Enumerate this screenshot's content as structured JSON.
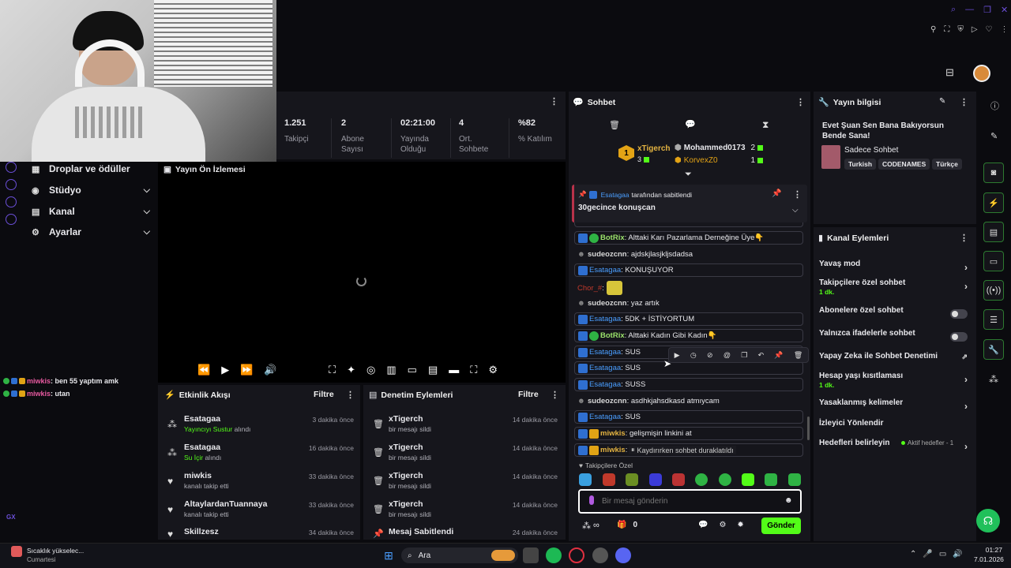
{
  "nav": {
    "items": [
      {
        "label": "Droplar ve ödüller"
      },
      {
        "label": "Stüdyo"
      },
      {
        "label": "Kanal"
      },
      {
        "label": "Ayarlar"
      }
    ]
  },
  "stats": [
    {
      "value": "1.251",
      "label": "Takipçi"
    },
    {
      "value": "2",
      "label": "Abone Sayısı"
    },
    {
      "value": "02:21:00",
      "label": "Yayında Olduğu"
    },
    {
      "value": "4",
      "label": "Ort. Sohbete"
    },
    {
      "value": "%82",
      "label": "% Katılım"
    }
  ],
  "preview": {
    "title": "Yayın Ön İzlemesi"
  },
  "overlay_chat": [
    {
      "user": "miwkis",
      "text": ": ben 55 yaptım amk"
    },
    {
      "user": "miwkis",
      "text": ": utan"
    }
  ],
  "activity": {
    "title": "Etkinlik Akışı",
    "filter": "Filtre",
    "items": [
      {
        "name": "Esatagaa",
        "action": "Yayıncıyı Sustur",
        "suffix": " alındı",
        "time": "3 dakika önce"
      },
      {
        "name": "Esatagaa",
        "action": "Su İçir",
        "suffix": " alındı",
        "time": "16 dakika önce"
      },
      {
        "name": "miwkis",
        "sub": "kanalı takip etti",
        "time": "33 dakika önce"
      },
      {
        "name": "AltaylardanTuannaya",
        "sub": "kanalı takip etti",
        "time": "33 dakika önce"
      },
      {
        "name": "Skillzesz",
        "time": "34 dakika önce"
      }
    ]
  },
  "moderation": {
    "title": "Denetim Eylemleri",
    "filter": "Filtre",
    "items": [
      {
        "name": "xTigerch",
        "sub": "bir mesajı sildi",
        "time": "14 dakika önce"
      },
      {
        "name": "xTigerch",
        "sub": "bir mesajı sildi",
        "time": "14 dakika önce"
      },
      {
        "name": "xTigerch",
        "sub": "bir mesajı sildi",
        "time": "14 dakika önce"
      },
      {
        "name": "xTigerch",
        "sub": "bir mesajı sildi",
        "time": "14 dakika önce"
      },
      {
        "name": "Mesaj Sabitlendi",
        "time": "24 dakika önce"
      }
    ]
  },
  "chat": {
    "title": "Sohbet",
    "top1": {
      "rank": "1",
      "name": "xTigerch",
      "count": "3"
    },
    "top_list": [
      {
        "name": "Mohammed0173",
        "count": "2"
      },
      {
        "name": "KorvexZ0",
        "count": "1"
      }
    ],
    "pinned": {
      "by": "Esatagaa",
      "by_suffix": " tarafından sabitlendi",
      "text": "30gecince konuşcan"
    },
    "messages": [
      {
        "user": "BotRix",
        "text": ": Alttaki Karı Pazarlama Derneğine Üye👇",
        "style": "bot"
      },
      {
        "user": "sudeozcnn",
        "text": ": ajdskjlasjkljsdadsa",
        "style": "plain"
      },
      {
        "user": "Esatagaa",
        "text": ": KONUŞUYOR",
        "style": "blue"
      },
      {
        "user": "Chor_#",
        "text": ":",
        "style": "red"
      },
      {
        "user": "sudeozcnn",
        "text": ": yaz artık",
        "style": "plain"
      },
      {
        "user": "Esatagaa",
        "text": ": 5DK + İSTİYORTUM",
        "style": "blue"
      },
      {
        "user": "BotRix",
        "text": ": Alttaki Kadın Gibi Kadın👇",
        "style": "bot"
      },
      {
        "user": "Esatagaa",
        "text": ": SUS",
        "style": "blue"
      },
      {
        "user": "Esatagaa",
        "text": ": SUS",
        "style": "blue"
      },
      {
        "user": "Esatagaa",
        "text": ": SUSS",
        "style": "blue"
      },
      {
        "user": "sudeozcnn",
        "text": ": asdhkjahsdkasd atmıycam",
        "style": "plain"
      },
      {
        "user": "Esatagaa",
        "text": ": SUS",
        "style": "blue"
      },
      {
        "user": "miwkis",
        "text": ": gelişmişin linkini at",
        "style": "gold"
      },
      {
        "user": "miwkis",
        "text": ": li",
        "style": "gold"
      }
    ],
    "paused_text": "Kaydırırken sohbet duraklatıldı",
    "followers_label": "Takipçilere Özel",
    "input_placeholder": "Bir mesaj gönderin",
    "points": "0",
    "send_label": "Gönder"
  },
  "stream_info": {
    "title": "Yayın bilgisi",
    "stream_title": "Evet Şuan Sen Bana Bakıyorsun Bende Sana!",
    "category": "Sadece Sohbet",
    "tags": [
      "Turkish",
      "CODENAMES",
      "Türkçe"
    ]
  },
  "channel_actions": {
    "title": "Kanal Eylemleri",
    "items": [
      {
        "label": "Yavaş mod",
        "kind": "chev"
      },
      {
        "label": "Takipçilere özel sohbet",
        "sub": "1 dk.",
        "kind": "chev"
      },
      {
        "label": "Abonelere özel sohbet",
        "kind": "toggle"
      },
      {
        "label": "Yalnızca ifadelerle sohbet",
        "kind": "toggle"
      },
      {
        "label": "Yapay Zeka ile Sohbet Denetimi",
        "kind": "ext"
      },
      {
        "label": "Hesap yaşı kısıtlaması",
        "sub": "1 dk.",
        "kind": "chev"
      },
      {
        "label": "Yasaklanmış kelimeler",
        "kind": "chev"
      },
      {
        "label": "İzleyici Yönlendir",
        "kind": "none"
      },
      {
        "label": "Hedefleri belirleyin",
        "extra": "Aktif hedefler - 1",
        "kind": "chev"
      }
    ]
  },
  "taskbar": {
    "weather": "Sıcaklık yükselec...",
    "weather_sub": "Cumartesi",
    "search": "Ara",
    "time": "01:27",
    "date": "7.01.2026"
  },
  "misc": {
    "gx": "GX"
  },
  "colors": {
    "accent": "#53fc18",
    "bg": "#0b0b0f",
    "panel": "#16161c"
  }
}
